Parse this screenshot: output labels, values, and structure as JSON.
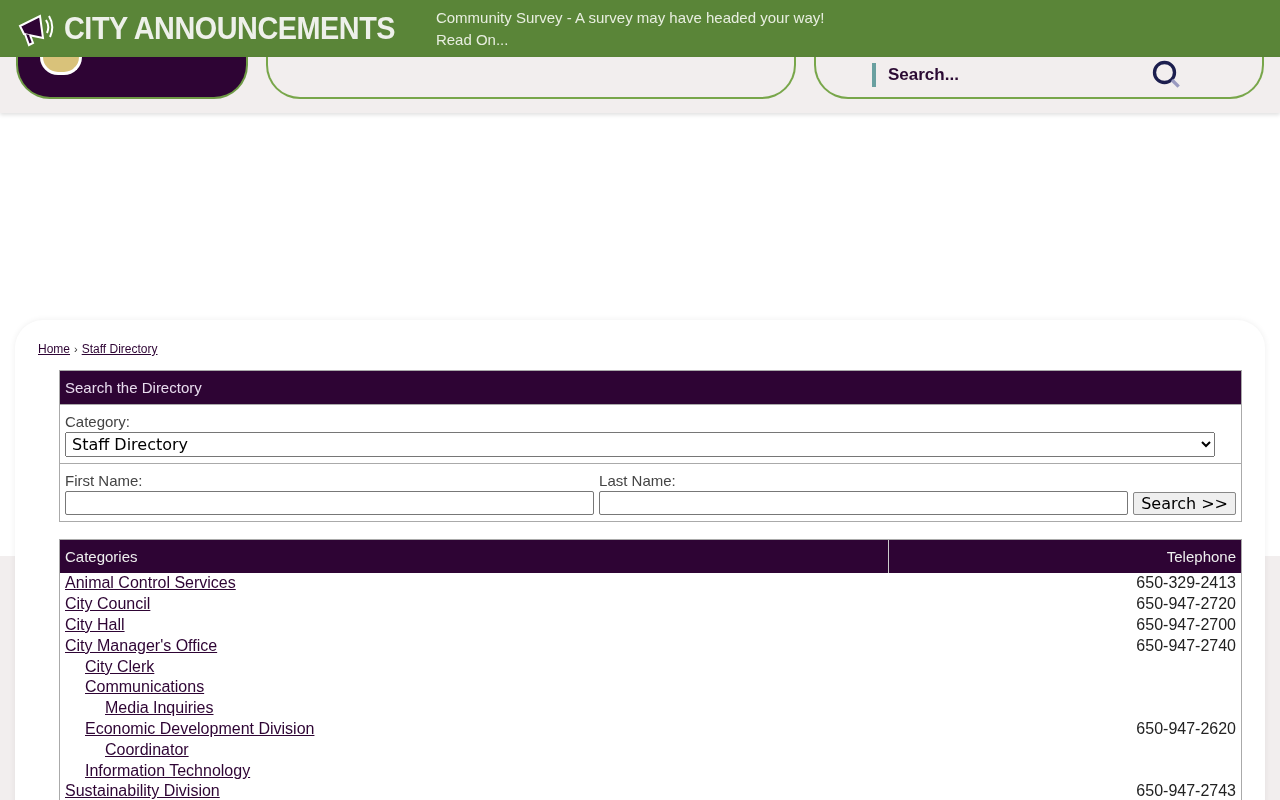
{
  "announcement": {
    "title": "CITY ANNOUNCEMENTS",
    "headline": "Community Survey - A survey may have headed your way!",
    "link": "Read On..."
  },
  "header": {
    "search": {
      "placeholder": "Search..."
    }
  },
  "breadcrumbs": [
    {
      "label": "Home"
    },
    {
      "separator": "›",
      "label": "Staff Directory"
    }
  ],
  "search_panel": {
    "title": "Search the Directory",
    "category_label": "Category:",
    "category_value": "Staff Directory",
    "first_name_label": "First Name:",
    "last_name_label": "Last Name:",
    "button": "Search >>"
  },
  "table": {
    "columns": [
      "Categories",
      "Telephone"
    ],
    "rows": [
      {
        "name": "Animal Control Services",
        "phone": "650-329-2413"
      },
      {
        "name": "City Council",
        "phone": "650-947-2720"
      },
      {
        "name": "City Hall",
        "phone": "650-947-2700"
      },
      {
        "name": "City Manager's Office",
        "phone": "650-947-2740",
        "children": [
          {
            "name": "City Clerk"
          },
          {
            "name": "Communications",
            "children": [
              {
                "name": "Media Inquiries"
              }
            ]
          },
          {
            "name": "Economic Development Division",
            "phone": "650-947-2620",
            "children": [
              {
                "name": "Coordinator"
              }
            ]
          },
          {
            "name": "Information Technology"
          }
        ]
      },
      {
        "name": "Sustainability Division",
        "phone": "650-947-2743"
      }
    ]
  }
}
